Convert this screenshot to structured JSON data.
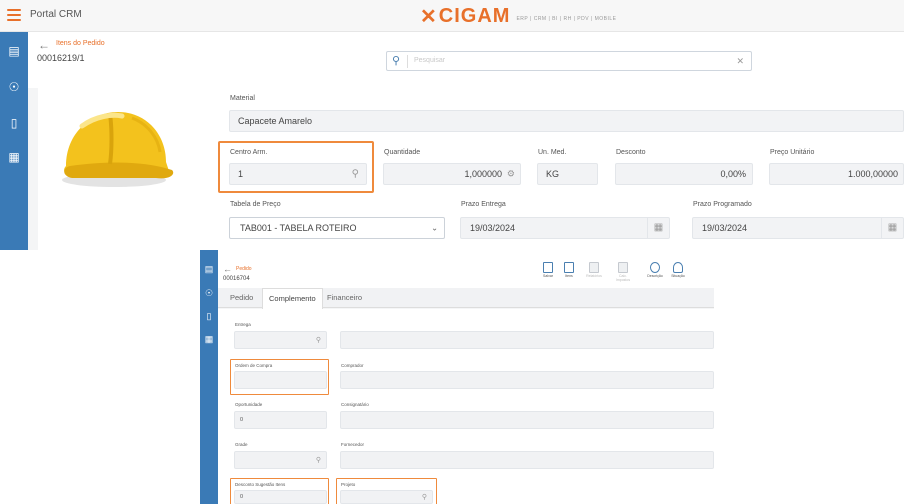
{
  "top": {
    "app_title": "Portal CRM",
    "logo": {
      "name": "CIGAM",
      "tagline": "ERP | CRM | BI | RH | PDV | MOBILE"
    },
    "breadcrumb": "Itens do Pedido",
    "doc_number": "00016219/1",
    "search": {
      "placeholder": "Pesquisar"
    },
    "material": {
      "label": "Material",
      "value": "Capacete Amarelo"
    },
    "centro_arm": {
      "label": "Centro Arm.",
      "value": "1"
    },
    "quantidade": {
      "label": "Quantidade",
      "value": "1,000000"
    },
    "un_med": {
      "label": "Un. Med.",
      "value": "KG"
    },
    "desconto": {
      "label": "Desconto",
      "value": "0,00%"
    },
    "preco_unitario": {
      "label": "Preço Unitário",
      "value": "1.000,00000"
    },
    "tabela_preco": {
      "label": "Tabela de Preço",
      "value": "TAB001 - TABELA ROTEIRO"
    },
    "prazo_entrega": {
      "label": "Prazo Entrega",
      "value": "19/03/2024"
    },
    "prazo_programado": {
      "label": "Prazo Programado",
      "value": "19/03/2024"
    }
  },
  "bottom": {
    "breadcrumb": "Pedido",
    "doc_number": "00016704",
    "toolbar": [
      {
        "label": "Salvar",
        "icon": "save-icon",
        "enabled": true
      },
      {
        "label": "Itens",
        "icon": "list-icon",
        "enabled": true
      },
      {
        "label": "Relatórios",
        "icon": "report-icon",
        "enabled": false
      },
      {
        "label": "Calc. Impostos",
        "icon": "calculator-icon",
        "enabled": false
      },
      {
        "label": "Descrição",
        "icon": "description-icon",
        "enabled": true
      },
      {
        "label": "Situação",
        "icon": "status-icon",
        "enabled": true
      }
    ],
    "tabs": [
      "Pedido",
      "Complemento",
      "Financeiro"
    ],
    "active_tab": "Complemento",
    "fields": {
      "entrega": {
        "label": "Entrega",
        "value": ""
      },
      "ordem_compra": {
        "label": "Ordem de Compra",
        "value": ""
      },
      "comprador": {
        "label": "Comprador",
        "value": ""
      },
      "oportunidade": {
        "label": "Oportunidade",
        "value": "0"
      },
      "consignatario": {
        "label": "Consignatário",
        "value": ""
      },
      "grade": {
        "label": "Grade",
        "value": ""
      },
      "fornecedor": {
        "label": "Fornecedor",
        "value": ""
      },
      "desconto_sugestao": {
        "label": "Desconto Sugestão Itens",
        "value": "0"
      },
      "projeto": {
        "label": "Projeto",
        "value": ""
      }
    }
  },
  "colors": {
    "accent": "#e8702a",
    "sidebar": "#3a7ab6",
    "highlight": "#ef8a3c"
  }
}
